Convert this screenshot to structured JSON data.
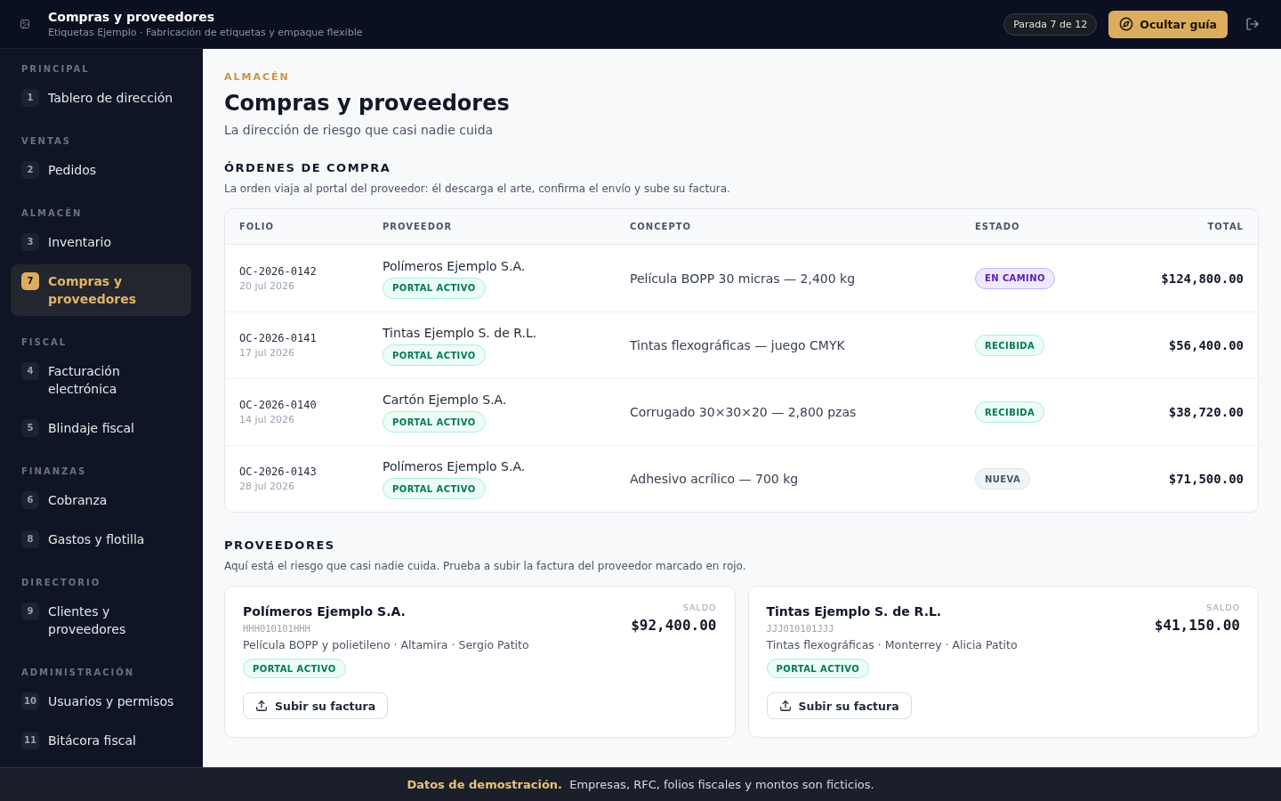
{
  "header": {
    "title": "Compras y proveedores",
    "subtitle": "Etiquetas Ejemplo · Fabricación de etiquetas y empaque flexible",
    "step": "Parada 7 de 12",
    "guide_button": "Ocultar guía"
  },
  "sidebar": {
    "sections": [
      {
        "title": "PRINCIPAL",
        "items": [
          {
            "number": "1",
            "label": "Tablero de dirección",
            "selected": false
          }
        ]
      },
      {
        "title": "VENTAS",
        "items": [
          {
            "number": "2",
            "label": "Pedidos",
            "selected": false
          }
        ]
      },
      {
        "title": "ALMACÉN",
        "items": [
          {
            "number": "3",
            "label": "Inventario",
            "selected": false
          },
          {
            "number": "7",
            "label": "Compras y proveedores",
            "selected": true
          }
        ]
      },
      {
        "title": "FISCAL",
        "items": [
          {
            "number": "4",
            "label": "Facturación electrónica",
            "selected": false
          },
          {
            "number": "5",
            "label": "Blindaje fiscal",
            "selected": false
          }
        ]
      },
      {
        "title": "FINANZAS",
        "items": [
          {
            "number": "6",
            "label": "Cobranza",
            "selected": false
          },
          {
            "number": "8",
            "label": "Gastos y flotilla",
            "selected": false
          }
        ]
      },
      {
        "title": "DIRECTORIO",
        "items": [
          {
            "number": "9",
            "label": "Clientes y proveedores",
            "selected": false
          }
        ]
      },
      {
        "title": "ADMINISTRACIÓN",
        "items": [
          {
            "number": "10",
            "label": "Usuarios y permisos",
            "selected": false
          },
          {
            "number": "11",
            "label": "Bitácora fiscal",
            "selected": false
          }
        ]
      }
    ]
  },
  "page": {
    "eyebrow": "ALMACÉN",
    "title": "Compras y proveedores",
    "subtitle": "La dirección de riesgo que casi nadie cuida"
  },
  "orders": {
    "title": "ÓRDENES DE COMPRA",
    "description": "La orden viaja al portal del proveedor: él descarga el arte, confirma el envío y sube su factura.",
    "columns": [
      "FOLIO",
      "PROVEEDOR",
      "CONCEPTO",
      "ESTADO",
      "TOTAL"
    ],
    "rows": [
      {
        "folio": "OC-2026-0142",
        "date": "20 jul 2026",
        "supplier": "Polímeros Ejemplo S.A.",
        "portal": {
          "label": "PORTAL ACTIVO",
          "active": true
        },
        "concept": "Película BOPP 30 micras — 2,400 kg",
        "status": {
          "label": "EN CAMINO",
          "kind": "transit"
        },
        "total": "$124,800.00"
      },
      {
        "folio": "OC-2026-0141",
        "date": "17 jul 2026",
        "supplier": "Tintas Ejemplo S. de R.L.",
        "portal": {
          "label": "PORTAL ACTIVO",
          "active": true
        },
        "concept": "Tintas flexográficas — juego CMYK",
        "status": {
          "label": "RECIBIDA",
          "kind": "received"
        },
        "total": "$56,400.00"
      },
      {
        "folio": "OC-2026-0140",
        "date": "14 jul 2026",
        "supplier": "Cartón Ejemplo S.A.",
        "portal": {
          "label": "PORTAL ACTIVO",
          "active": true
        },
        "concept": "Corrugado 30×30×20 — 2,800 pzas",
        "status": {
          "label": "RECIBIDA",
          "kind": "received"
        },
        "total": "$38,720.00"
      },
      {
        "folio": "OC-2026-0143",
        "date": "28 jul 2026",
        "supplier": "Polímeros Ejemplo S.A.",
        "portal": {
          "label": "PORTAL ACTIVO",
          "active": true
        },
        "concept": "Adhesivo acrílico — 700 kg",
        "status": {
          "label": "NUEVA",
          "kind": "new"
        },
        "total": "$71,500.00"
      }
    ]
  },
  "suppliers": {
    "title": "PROVEEDORES",
    "description": "Aquí está el riesgo que casi nadie cuida. Prueba a subir la factura del proveedor marcado en rojo.",
    "cards": [
      {
        "name": "Polímeros Ejemplo S.A.",
        "rfc": "HHH010101HHH",
        "details": "Película BOPP y polietileno · Altamira · Sergio Patito",
        "portal": {
          "label": "PORTAL ACTIVO",
          "active": true
        },
        "balance_label": "SALDO",
        "balance": "$92,400.00",
        "upload_button": "Subir su factura"
      },
      {
        "name": "Tintas Ejemplo S. de R.L.",
        "rfc": "JJJ010101JJJ",
        "details": "Tintas flexográficas · Monterrey · Alicia Patito",
        "portal": {
          "label": "PORTAL ACTIVO",
          "active": true
        },
        "balance_label": "SALDO",
        "balance": "$41,150.00",
        "upload_button": "Subir su factura"
      }
    ]
  },
  "demo_banner": {
    "text": "**Datos de demostración.** Empresas, RFC, folios fiscales y montos son ficticios."
  }
}
